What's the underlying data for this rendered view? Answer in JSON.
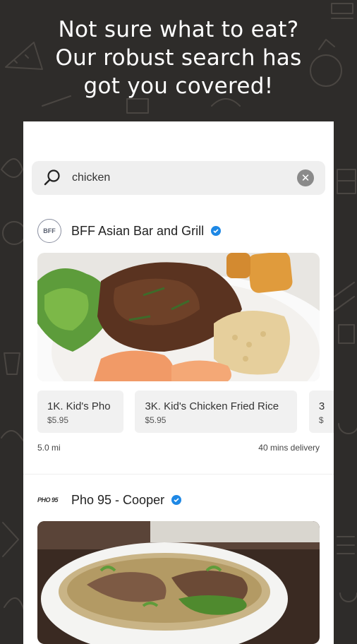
{
  "headline": {
    "line1": "Not sure what to eat?",
    "line2": "Our robust search has",
    "line3": "got you covered!"
  },
  "search": {
    "query": "chicken",
    "search_icon": "search-icon",
    "clear_icon": "clear-icon",
    "clear_glyph": "✕"
  },
  "restaurants": [
    {
      "logo_text": "BFF",
      "name": "BFF Asian Bar and Grill",
      "verified_icon": "verified-icon",
      "menu_items": [
        {
          "name": "1K. Kid's Pho",
          "price": "$5.95"
        },
        {
          "name": "3K. Kid's Chicken Fried Rice",
          "price": "$5.95"
        },
        {
          "name": "3",
          "price": "$"
        }
      ],
      "distance": "5.0 mi",
      "delivery": "40 mins delivery"
    },
    {
      "logo_text": "PHO 95",
      "name": "Pho 95 - Cooper",
      "verified_icon": "verified-icon"
    }
  ],
  "colors": {
    "background": "#2e2c2a",
    "card": "#ffffff",
    "verified": "#1e88e5",
    "search_bg": "#efefef"
  }
}
